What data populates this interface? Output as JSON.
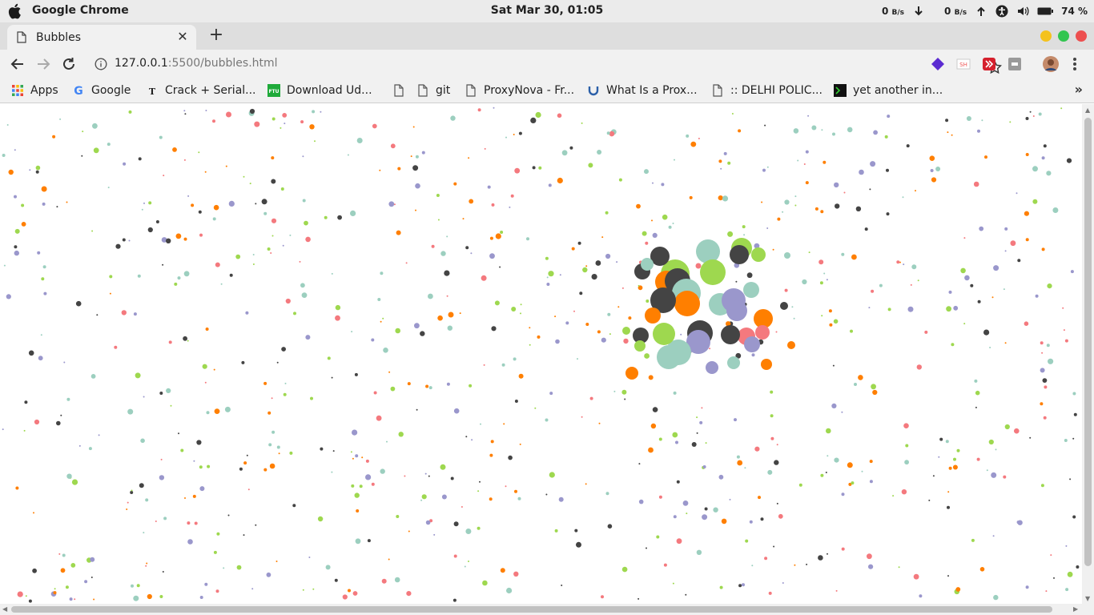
{
  "os": {
    "app_name": "Google Chrome",
    "clock": "Sat Mar 30, 01:05",
    "net_down_value": "0",
    "net_down_unit": "B/s",
    "net_up_value": "0",
    "net_up_unit": "B/s",
    "battery": "74 %"
  },
  "tab": {
    "title": "Bubbles"
  },
  "address": {
    "host": "127.0.0.1",
    "rest": ":5500/bubbles.html"
  },
  "bookmarks": [
    {
      "label": "Apps",
      "icon": "apps-grid-icon"
    },
    {
      "label": "Google",
      "icon": "google-icon"
    },
    {
      "label": "Crack + Serial...",
      "icon": "tipu-icon"
    },
    {
      "label": "Download Ud...",
      "icon": "ftu-icon"
    },
    {
      "label": "",
      "icon": "page-icon"
    },
    {
      "label": "git",
      "icon": "page-icon"
    },
    {
      "label": "ProxyNova - Fr...",
      "icon": "page-icon"
    },
    {
      "label": "What Is a Prox...",
      "icon": "vpn-icon"
    },
    {
      "label": ":: DELHI POLIC...",
      "icon": "page-icon"
    },
    {
      "label": "yet another in...",
      "icon": "terminal-icon"
    }
  ],
  "colors": {
    "bubble_palette": [
      "#ff7f00",
      "#9ccfbf",
      "#9a97cc",
      "#444444",
      "#9ed84f",
      "#f4797e"
    ],
    "window_close": "#ed4f4f",
    "window_max": "#32c550",
    "window_min": "#f4c21d"
  }
}
